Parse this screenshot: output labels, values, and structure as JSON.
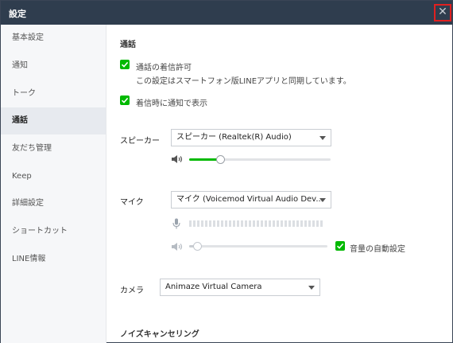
{
  "window": {
    "title": "設定",
    "close_icon": "close-icon"
  },
  "sidebar": {
    "items": [
      {
        "label": "基本設定",
        "active": false
      },
      {
        "label": "通知",
        "active": false
      },
      {
        "label": "トーク",
        "active": false
      },
      {
        "label": "通話",
        "active": true
      },
      {
        "label": "友だち管理",
        "active": false
      },
      {
        "label": "Keep",
        "active": false
      },
      {
        "label": "詳細設定",
        "active": false
      },
      {
        "label": "ショートカット",
        "active": false
      },
      {
        "label": "LINE情報",
        "active": false
      }
    ]
  },
  "main": {
    "section_title": "通話",
    "allow_incoming": {
      "label": "通話の着信許可",
      "sublabel": "この設定はスマートフォン版LINEアプリと同期しています。",
      "checked": true
    },
    "notify_incoming": {
      "label": "着信時に通知で表示",
      "checked": true
    },
    "speaker": {
      "label": "スピーカー",
      "selected": "スピーカー (Realtek(R) Audio)",
      "volume_fraction": 0.22
    },
    "mic": {
      "label": "マイク",
      "selected": "マイク (Voicemod Virtual Audio Dev...",
      "level_fraction": 0.0,
      "volume_fraction": 0.06,
      "auto_volume": {
        "label": "音量の自動設定",
        "checked": true
      }
    },
    "camera": {
      "label": "カメラ",
      "selected": "Animaze Virtual Camera"
    },
    "noise_cancel": {
      "label": "ノイズキャンセリング"
    }
  },
  "colors": {
    "titlebar": "#2f3d4e",
    "accent": "#00b900",
    "close_highlight": "#e02020"
  }
}
